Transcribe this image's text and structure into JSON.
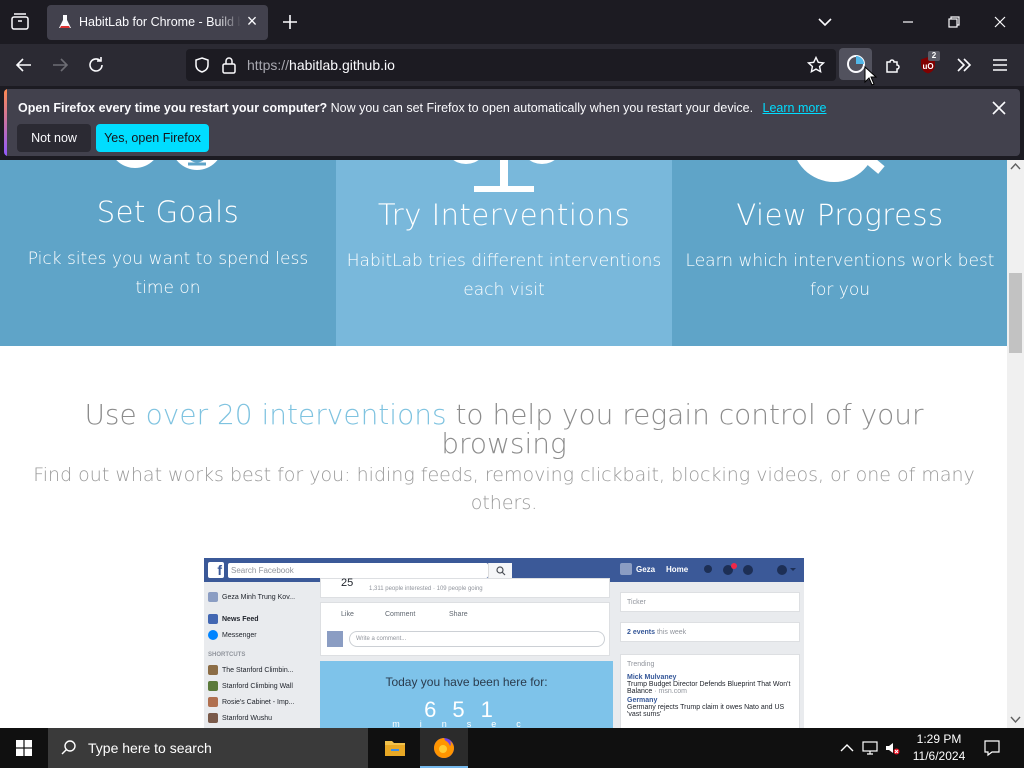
{
  "browser": {
    "tab": {
      "title": "HabitLab for Chrome - Build better habits"
    },
    "url": {
      "protocol": "https://",
      "host": "habitlab.github.io"
    },
    "extension_badge": "2"
  },
  "notification": {
    "title": "Open Firefox every time you restart your computer?",
    "body": "Now you can set Firefox to open automatically when you restart your device.",
    "link": "Learn more",
    "not_now": "Not now",
    "yes": "Yes, open Firefox"
  },
  "page": {
    "features": [
      {
        "title": "Set Goals",
        "desc": "Pick sites you want to spend less time on"
      },
      {
        "title": "Try Interventions",
        "desc": "HabitLab tries different interventions each visit"
      },
      {
        "title": "View Progress",
        "desc": "Learn which interventions work best for you"
      }
    ],
    "headline": {
      "pre": "Use ",
      "highlight": "over 20 interventions",
      "post": " to help you regain control of your browsing"
    },
    "subline": "Find out what works best for you: hiding feeds, removing clickbait, blocking videos, or one of many others.",
    "fb": {
      "search": "Search Facebook",
      "user": "Geza",
      "home": "Home",
      "profile": "Geza Minh Trung Kov...",
      "news_feed": "News Feed",
      "messenger": "Messenger",
      "shortcuts": "SHORTCUTS",
      "shortcut_items": [
        "The Stanford Climbin...",
        "Stanford Climbing Wall",
        "Rosie's Cabinet - Imp...",
        "Stanford Wushu"
      ],
      "event_num": "25",
      "event_meta": "1,311 people interested · 109 people going",
      "like": "Like",
      "comment": "Comment",
      "share": "Share",
      "write_comment": "Write a comment...",
      "today_label": "Today you have been here for:",
      "minutes": "6",
      "seconds": "51",
      "min_unit": "min",
      "sec_unit": "sec",
      "ticker": "Ticker",
      "events": "2 events",
      "events_suffix": "this week",
      "trending": "Trending",
      "trend1_name": "Mick Mulvaney",
      "trend1_text": "Trump Budget Director Defends Blueprint That Won't Balance",
      "trend1_src": "· msn.com",
      "trend2_name": "Germany",
      "trend2_text": "Germany rejects Trump claim it owes Nato and US 'vast sums'"
    }
  },
  "taskbar": {
    "search_placeholder": "Type here to search",
    "time": "1:29 PM",
    "date": "11/6/2024"
  },
  "colors": {
    "feature_dark": "#5fa4c8",
    "feature_light": "#79b8db",
    "link": "#00ddff",
    "highlight": "#7fc3e0"
  }
}
